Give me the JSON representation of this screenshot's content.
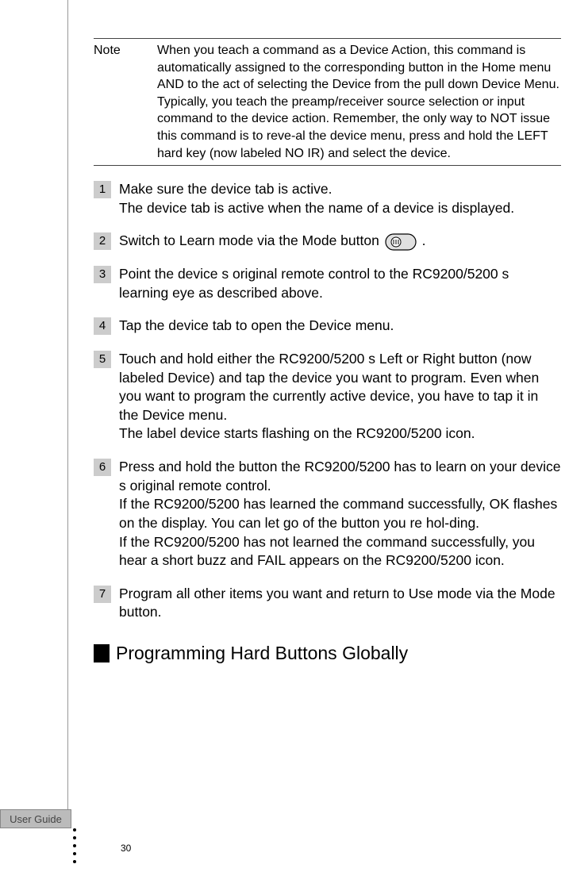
{
  "note": {
    "label": "Note",
    "text": "When you teach a command as a Device Action, this command is automatically assigned to the corresponding button in the Home menu AND to the act of selecting the Device from the pull down Device Menu. Typically, you teach the preamp/receiver source selection or  input  command to the device action. Remember, the only way to NOT issue this command is to reve-al the device menu, press and hold the LEFT hard key (now labeled NO IR) and select the device."
  },
  "steps": [
    {
      "num": "1",
      "text": "Make sure the device tab is active.\nThe device tab is active when the name of a device is displayed."
    },
    {
      "num": "2",
      "text_before": "Switch to Learn mode via the Mode button ",
      "text_after": "."
    },
    {
      "num": "3",
      "text": "Point the device s original remote control to the RC9200/5200 s learning eye as described above."
    },
    {
      "num": "4",
      "text": "Tap the device tab to open the Device menu."
    },
    {
      "num": "5",
      "text": "Touch and hold either the RC9200/5200 s Left or Right button (now labeled Device) and tap the device you want to program. Even when you want to program the currently active device, you have to tap it in the Device menu.\nThe label  device  starts flashing on the RC9200/5200 icon."
    },
    {
      "num": "6",
      "text": "Press and hold the button the RC9200/5200 has to learn on your device s original remote control.\nIf the RC9200/5200 has learned the command successfully, OK flashes on the display. You can let go of the button you re hol-ding.\nIf the RC9200/5200 has not learned the command successfully, you hear a short buzz and FAIL appears on the RC9200/5200 icon."
    },
    {
      "num": "7",
      "text": "Program all other items you want and return to Use mode via the Mode button."
    }
  ],
  "section_title": "Programming Hard Buttons Globally",
  "footer_label": "User Guide",
  "page_number": "30"
}
